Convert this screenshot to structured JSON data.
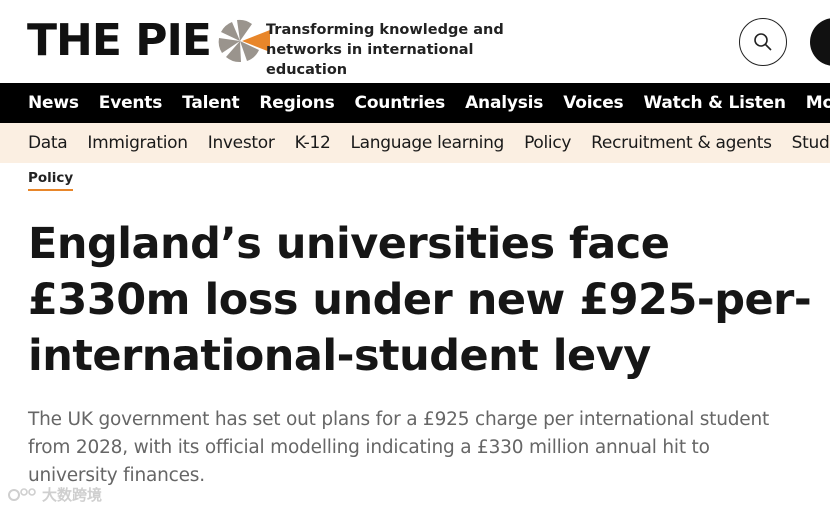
{
  "header": {
    "logo_text": "THE PIE",
    "tagline": "Transforming knowledge and networks in international education",
    "search_icon": "search-icon",
    "menu_icon": "menu-icon"
  },
  "main_nav": {
    "items": [
      {
        "label": "News"
      },
      {
        "label": "Events"
      },
      {
        "label": "Talent"
      },
      {
        "label": "Regions"
      },
      {
        "label": "Countries"
      },
      {
        "label": "Analysis"
      },
      {
        "label": "Voices"
      },
      {
        "label": "Watch & Listen"
      },
      {
        "label": "Movers"
      }
    ]
  },
  "sub_nav": {
    "items": [
      {
        "label": "Data"
      },
      {
        "label": "Immigration"
      },
      {
        "label": "Investor"
      },
      {
        "label": "K-12"
      },
      {
        "label": "Language learning"
      },
      {
        "label": "Policy"
      },
      {
        "label": "Recruitment & agents"
      },
      {
        "label": "Study ab"
      }
    ]
  },
  "article": {
    "category": "Policy",
    "headline": "England’s universities face £330m loss under new £925-per-international-student levy",
    "standfirst": "The UK government has set out plans for a £925 charge per international student from 2028, with its official modelling indicating a £330 million annual hit to university finances."
  },
  "watermark": {
    "text": "大数跨境"
  },
  "colors": {
    "nav_bg": "#000000",
    "sub_nav_bg": "#fbefe2",
    "accent": "#e8862a",
    "logo_grey": "#9a948d"
  }
}
